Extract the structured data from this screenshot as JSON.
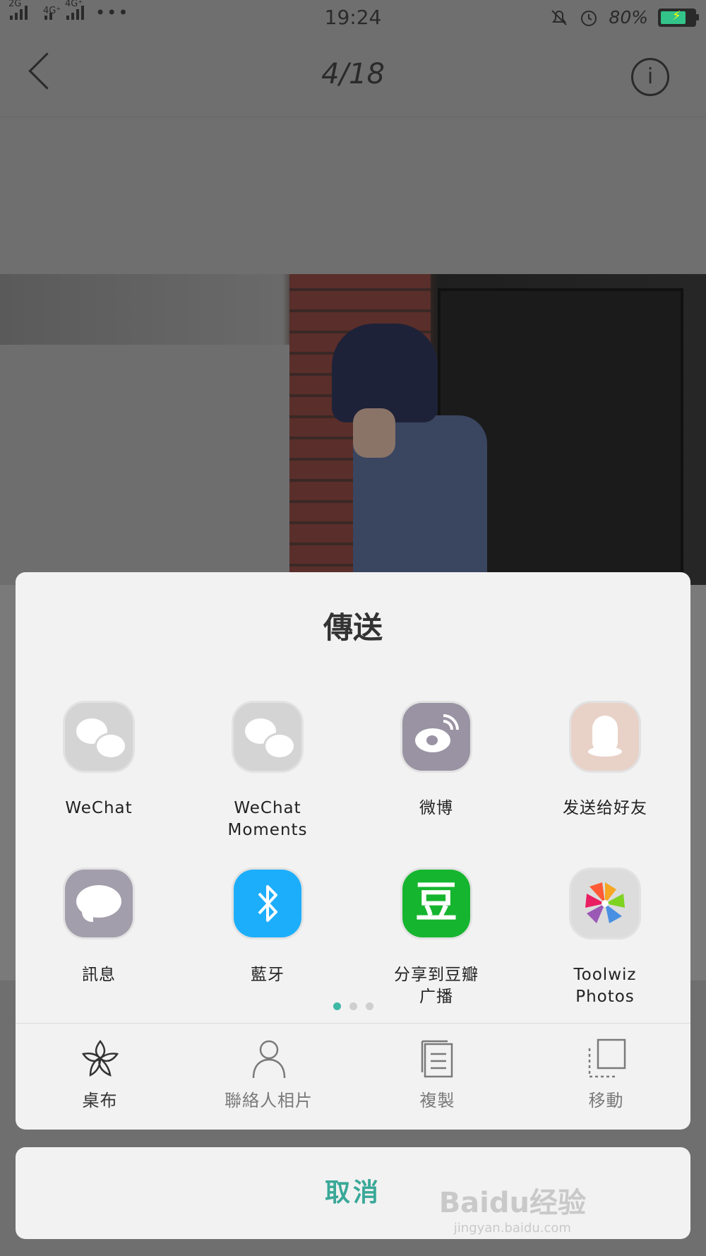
{
  "status_bar": {
    "signal1_tag": "2G",
    "signal2_tag": "4G⁺",
    "signal3_tag": "4G⁺",
    "more": "•••",
    "time": "19:24",
    "battery_percent": "80%",
    "battery_level": 0.8
  },
  "viewer": {
    "counter": "4/18",
    "info_icon": "i"
  },
  "share_sheet": {
    "title": "傳送",
    "apps": [
      {
        "label": "WeChat",
        "icon": "wechat-icon"
      },
      {
        "label": "WeChat\nMoments",
        "icon": "wechat-icon"
      },
      {
        "label": "微博",
        "icon": "weibo-icon"
      },
      {
        "label": "发送给好友",
        "icon": "qq-icon"
      },
      {
        "label": "訊息",
        "icon": "message-icon"
      },
      {
        "label": "藍牙",
        "icon": "bluetooth-icon"
      },
      {
        "label": "分享到豆瓣\n广播",
        "icon": "douban-icon"
      },
      {
        "label": "Toolwiz\nPhotos",
        "icon": "toolwiz-icon"
      }
    ],
    "douban_glyph": "豆",
    "page_indicator": {
      "pages": 3,
      "current": 1
    },
    "actions": [
      {
        "label": "桌布",
        "icon": "flower-icon"
      },
      {
        "label": "聯絡人相片",
        "icon": "person-icon"
      },
      {
        "label": "複製",
        "icon": "copy-icon"
      },
      {
        "label": "移動",
        "icon": "move-icon"
      }
    ]
  },
  "cancel": {
    "label": "取消"
  },
  "watermark": {
    "text": "Baidu经验",
    "sub": "jingyan.baidu.com"
  },
  "colors": {
    "accent": "#3aa898",
    "bluetooth": "#1daefb",
    "douban": "#16b52f"
  }
}
